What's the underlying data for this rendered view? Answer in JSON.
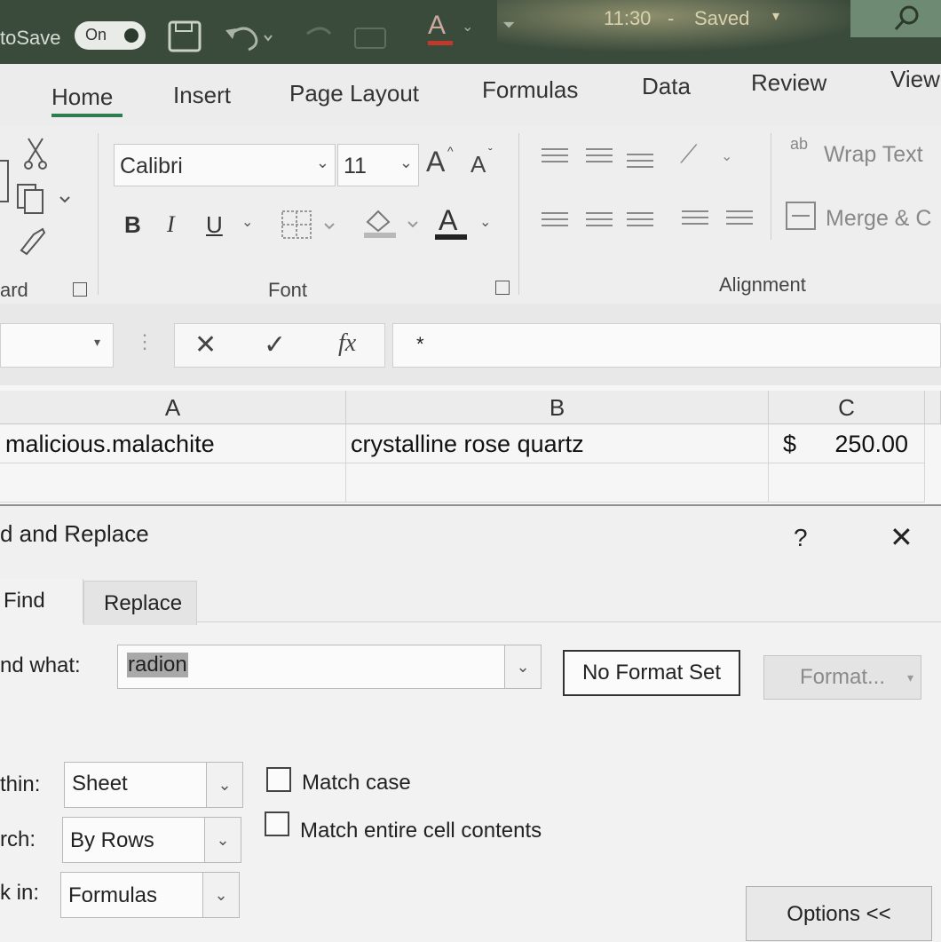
{
  "titlebar": {
    "autosave_label": "toSave",
    "autosave_state": "On",
    "font_color_glyph": "A",
    "time_text": "11:30",
    "status_text": "Saved",
    "icons": [
      "save-icon",
      "undo-icon",
      "redo-icon",
      "font-color-icon",
      "customize-icon",
      "search-icon"
    ]
  },
  "ribbon": {
    "tabs": [
      "Home",
      "Insert",
      "Page Layout",
      "Formulas",
      "Data",
      "Review",
      "View"
    ],
    "active_tab": "Home",
    "font_name": "Calibri",
    "font_size": "11",
    "increase_font": "A",
    "decrease_font": "A",
    "bold": "B",
    "italic": "I",
    "underline": "U",
    "font_color": "A",
    "wrap_text": "Wrap Text",
    "wrap_text_glyph": "ab",
    "merge": "Merge & C",
    "groups": {
      "clipboard": "ard",
      "font": "Font",
      "alignment": "Alignment"
    }
  },
  "formula_bar": {
    "name_box": "",
    "fx": "fx",
    "content": "*"
  },
  "grid": {
    "columns": [
      "A",
      "B",
      "C"
    ],
    "rows": [
      {
        "A": "malicious.malachite",
        "B": "crystalline rose quartz",
        "C_currency": "$",
        "C_value": "250.00"
      },
      {
        "A": "",
        "B": "",
        "C_currency": "",
        "C_value": ""
      }
    ]
  },
  "dialog": {
    "title": "d and Replace",
    "help": "?",
    "close": "✕",
    "tabs": [
      "Find",
      "Replace"
    ],
    "find_label": "nd what:",
    "find_value": "radion",
    "no_format": "No Format Set",
    "format_button": "Format...",
    "within_label": "thin:",
    "within_value": "Sheet",
    "search_label": "rch:",
    "search_value": "By Rows",
    "lookin_label": "k in:",
    "lookin_value": "Formulas",
    "match_case": "Match case",
    "match_entire": "Match entire cell contents",
    "options_button": "Options <<",
    "match_case_checked": false,
    "match_entire_checked": false
  },
  "colors": {
    "titlebar": "#3a4a3b",
    "accent": "#2e7d4f",
    "ribbon_bg": "#eeeeee",
    "selection": "#a9a9a9"
  }
}
